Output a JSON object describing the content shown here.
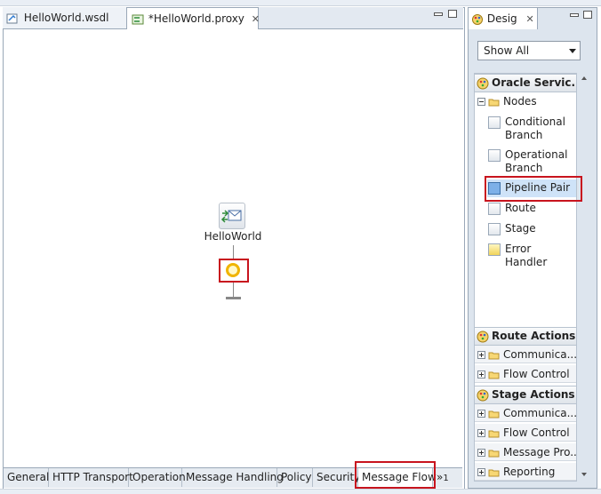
{
  "editor": {
    "tabs": [
      {
        "label": "HelloWorld.wsdl",
        "icon": "wsdl-file-icon"
      },
      {
        "label": "*HelloWorld.proxy",
        "icon": "proxy-service-icon",
        "close": "✕"
      }
    ]
  },
  "canvas": {
    "service_label": "HelloWorld"
  },
  "bottom_tabs": [
    "General",
    "HTTP Transport",
    "Operation",
    "Message Handling",
    "Policy",
    "Security",
    "Message Flow"
  ],
  "bottom_overflow": "»",
  "bottom_overflow_count": "1",
  "design": {
    "tab_label": "Desig",
    "tab_close": "✕",
    "select_value": "Show All",
    "drawers": [
      {
        "label": "Oracle Servic..."
      },
      {
        "label": "Route Actions"
      },
      {
        "label": "Stage Actions"
      }
    ],
    "nodes_folder": "Nodes",
    "node_items": [
      "Conditional Branch",
      "Operational Branch",
      "Pipeline Pair",
      "Route",
      "Stage",
      "Error Handler"
    ],
    "route_folders": [
      "Communica...",
      "Flow Control"
    ],
    "stage_folders": [
      "Communica...",
      "Flow Control",
      "Message Pro...",
      "Reporting"
    ]
  },
  "colors": {
    "highlight": "#c8141e",
    "flow_circle": "#f0b400"
  }
}
